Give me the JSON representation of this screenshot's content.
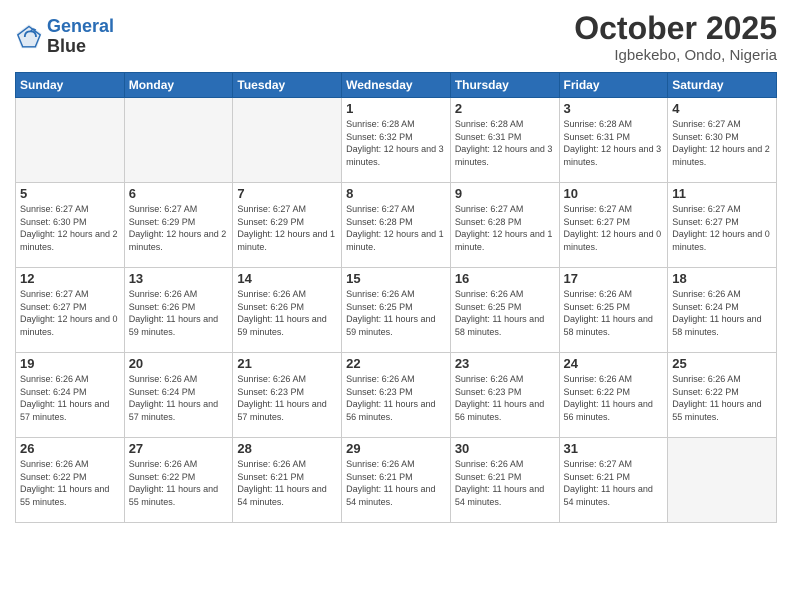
{
  "header": {
    "logo_line1": "General",
    "logo_line2": "Blue",
    "title": "October 2025",
    "subtitle": "Igbekebo, Ondo, Nigeria"
  },
  "weekdays": [
    "Sunday",
    "Monday",
    "Tuesday",
    "Wednesday",
    "Thursday",
    "Friday",
    "Saturday"
  ],
  "weeks": [
    [
      {
        "day": "",
        "sunrise": "",
        "sunset": "",
        "daylight": "",
        "empty": true
      },
      {
        "day": "",
        "sunrise": "",
        "sunset": "",
        "daylight": "",
        "empty": true
      },
      {
        "day": "",
        "sunrise": "",
        "sunset": "",
        "daylight": "",
        "empty": true
      },
      {
        "day": "1",
        "sunrise": "Sunrise: 6:28 AM",
        "sunset": "Sunset: 6:32 PM",
        "daylight": "Daylight: 12 hours and 3 minutes."
      },
      {
        "day": "2",
        "sunrise": "Sunrise: 6:28 AM",
        "sunset": "Sunset: 6:31 PM",
        "daylight": "Daylight: 12 hours and 3 minutes."
      },
      {
        "day": "3",
        "sunrise": "Sunrise: 6:28 AM",
        "sunset": "Sunset: 6:31 PM",
        "daylight": "Daylight: 12 hours and 3 minutes."
      },
      {
        "day": "4",
        "sunrise": "Sunrise: 6:27 AM",
        "sunset": "Sunset: 6:30 PM",
        "daylight": "Daylight: 12 hours and 2 minutes."
      }
    ],
    [
      {
        "day": "5",
        "sunrise": "Sunrise: 6:27 AM",
        "sunset": "Sunset: 6:30 PM",
        "daylight": "Daylight: 12 hours and 2 minutes."
      },
      {
        "day": "6",
        "sunrise": "Sunrise: 6:27 AM",
        "sunset": "Sunset: 6:29 PM",
        "daylight": "Daylight: 12 hours and 2 minutes."
      },
      {
        "day": "7",
        "sunrise": "Sunrise: 6:27 AM",
        "sunset": "Sunset: 6:29 PM",
        "daylight": "Daylight: 12 hours and 1 minute."
      },
      {
        "day": "8",
        "sunrise": "Sunrise: 6:27 AM",
        "sunset": "Sunset: 6:28 PM",
        "daylight": "Daylight: 12 hours and 1 minute."
      },
      {
        "day": "9",
        "sunrise": "Sunrise: 6:27 AM",
        "sunset": "Sunset: 6:28 PM",
        "daylight": "Daylight: 12 hours and 1 minute."
      },
      {
        "day": "10",
        "sunrise": "Sunrise: 6:27 AM",
        "sunset": "Sunset: 6:27 PM",
        "daylight": "Daylight: 12 hours and 0 minutes."
      },
      {
        "day": "11",
        "sunrise": "Sunrise: 6:27 AM",
        "sunset": "Sunset: 6:27 PM",
        "daylight": "Daylight: 12 hours and 0 minutes."
      }
    ],
    [
      {
        "day": "12",
        "sunrise": "Sunrise: 6:27 AM",
        "sunset": "Sunset: 6:27 PM",
        "daylight": "Daylight: 12 hours and 0 minutes."
      },
      {
        "day": "13",
        "sunrise": "Sunrise: 6:26 AM",
        "sunset": "Sunset: 6:26 PM",
        "daylight": "Daylight: 11 hours and 59 minutes."
      },
      {
        "day": "14",
        "sunrise": "Sunrise: 6:26 AM",
        "sunset": "Sunset: 6:26 PM",
        "daylight": "Daylight: 11 hours and 59 minutes."
      },
      {
        "day": "15",
        "sunrise": "Sunrise: 6:26 AM",
        "sunset": "Sunset: 6:25 PM",
        "daylight": "Daylight: 11 hours and 59 minutes."
      },
      {
        "day": "16",
        "sunrise": "Sunrise: 6:26 AM",
        "sunset": "Sunset: 6:25 PM",
        "daylight": "Daylight: 11 hours and 58 minutes."
      },
      {
        "day": "17",
        "sunrise": "Sunrise: 6:26 AM",
        "sunset": "Sunset: 6:25 PM",
        "daylight": "Daylight: 11 hours and 58 minutes."
      },
      {
        "day": "18",
        "sunrise": "Sunrise: 6:26 AM",
        "sunset": "Sunset: 6:24 PM",
        "daylight": "Daylight: 11 hours and 58 minutes."
      }
    ],
    [
      {
        "day": "19",
        "sunrise": "Sunrise: 6:26 AM",
        "sunset": "Sunset: 6:24 PM",
        "daylight": "Daylight: 11 hours and 57 minutes."
      },
      {
        "day": "20",
        "sunrise": "Sunrise: 6:26 AM",
        "sunset": "Sunset: 6:24 PM",
        "daylight": "Daylight: 11 hours and 57 minutes."
      },
      {
        "day": "21",
        "sunrise": "Sunrise: 6:26 AM",
        "sunset": "Sunset: 6:23 PM",
        "daylight": "Daylight: 11 hours and 57 minutes."
      },
      {
        "day": "22",
        "sunrise": "Sunrise: 6:26 AM",
        "sunset": "Sunset: 6:23 PM",
        "daylight": "Daylight: 11 hours and 56 minutes."
      },
      {
        "day": "23",
        "sunrise": "Sunrise: 6:26 AM",
        "sunset": "Sunset: 6:23 PM",
        "daylight": "Daylight: 11 hours and 56 minutes."
      },
      {
        "day": "24",
        "sunrise": "Sunrise: 6:26 AM",
        "sunset": "Sunset: 6:22 PM",
        "daylight": "Daylight: 11 hours and 56 minutes."
      },
      {
        "day": "25",
        "sunrise": "Sunrise: 6:26 AM",
        "sunset": "Sunset: 6:22 PM",
        "daylight": "Daylight: 11 hours and 55 minutes."
      }
    ],
    [
      {
        "day": "26",
        "sunrise": "Sunrise: 6:26 AM",
        "sunset": "Sunset: 6:22 PM",
        "daylight": "Daylight: 11 hours and 55 minutes."
      },
      {
        "day": "27",
        "sunrise": "Sunrise: 6:26 AM",
        "sunset": "Sunset: 6:22 PM",
        "daylight": "Daylight: 11 hours and 55 minutes."
      },
      {
        "day": "28",
        "sunrise": "Sunrise: 6:26 AM",
        "sunset": "Sunset: 6:21 PM",
        "daylight": "Daylight: 11 hours and 54 minutes."
      },
      {
        "day": "29",
        "sunrise": "Sunrise: 6:26 AM",
        "sunset": "Sunset: 6:21 PM",
        "daylight": "Daylight: 11 hours and 54 minutes."
      },
      {
        "day": "30",
        "sunrise": "Sunrise: 6:26 AM",
        "sunset": "Sunset: 6:21 PM",
        "daylight": "Daylight: 11 hours and 54 minutes."
      },
      {
        "day": "31",
        "sunrise": "Sunrise: 6:27 AM",
        "sunset": "Sunset: 6:21 PM",
        "daylight": "Daylight: 11 hours and 54 minutes."
      },
      {
        "day": "",
        "sunrise": "",
        "sunset": "",
        "daylight": "",
        "empty": true
      }
    ]
  ]
}
